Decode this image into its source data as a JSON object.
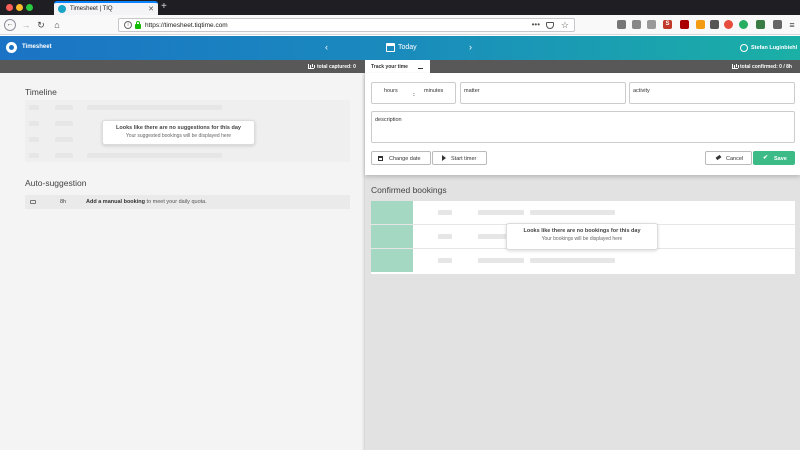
{
  "browser": {
    "tab_title": "Timesheet | TIQ",
    "url": "https://timesheet.tiqtime.com"
  },
  "header": {
    "app_name": "Timesheet",
    "date_label": "Today",
    "user_name": "Stefan Luginbiehl"
  },
  "subbar": {
    "total_captured": "total captured: 0",
    "tab_label": "Track your time",
    "total_confirmed": "total confirmed: 0 / 8h"
  },
  "timeline": {
    "title": "Timeline",
    "empty_title": "Looks like there are no suggestions for this day",
    "empty_sub": "Your suggested bookings will be displayed here"
  },
  "autosuggestion": {
    "title": "Auto-suggestion",
    "hours": "8h",
    "action": "Add a manual booking",
    "rest": " to meet your daily quota."
  },
  "form": {
    "hours": "hours",
    "colon": ":",
    "minutes": "minutes",
    "matter": "matter",
    "activity": "activity",
    "description": "description",
    "change_date": "Change date",
    "start_timer": "Start timer",
    "cancel": "Cancel",
    "save": "Save"
  },
  "confirmed": {
    "title": "Confirmed bookings",
    "empty_title": "Looks like there are no bookings for this day",
    "empty_sub": "Your bookings will be displayed here"
  }
}
